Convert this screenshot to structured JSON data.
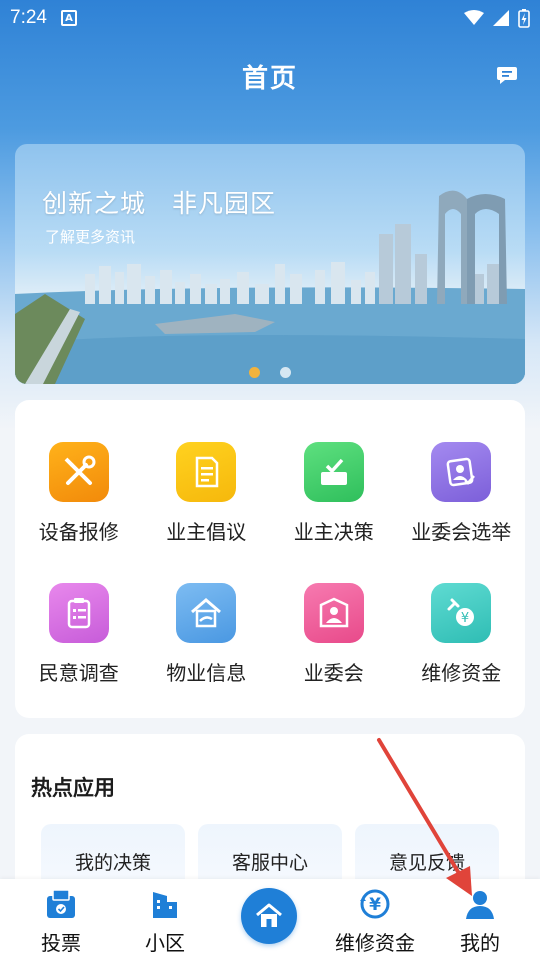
{
  "status_bar": {
    "time": "7:24",
    "notification_badge": "A"
  },
  "header": {
    "title": "首页"
  },
  "banner": {
    "title": "创新之城　非凡园区",
    "subtitle": "了解更多资讯",
    "active_dot": 0,
    "dot_count": 2
  },
  "menu": {
    "items": [
      {
        "label": "设备报修",
        "icon": "wrench-screwdriver-icon",
        "color": "#f59b0b"
      },
      {
        "label": "业主倡议",
        "icon": "document-icon",
        "color": "#f8c20e"
      },
      {
        "label": "业主决策",
        "icon": "ballot-box-icon",
        "color": "#3fcf6b"
      },
      {
        "label": "业委会选举",
        "icon": "election-card-icon",
        "color": "#8b6fe0"
      },
      {
        "label": "民意调查",
        "icon": "survey-clipboard-icon",
        "color": "#d86fe0"
      },
      {
        "label": "物业信息",
        "icon": "house-hand-icon",
        "color": "#5aa7ea"
      },
      {
        "label": "业委会",
        "icon": "committee-people-icon",
        "color": "#f0569a"
      },
      {
        "label": "维修资金",
        "icon": "yuan-fund-icon",
        "color": "#39c9c0"
      }
    ]
  },
  "hot_apps": {
    "title": "热点应用",
    "items": [
      {
        "label": "我的决策"
      },
      {
        "label": "客服中心"
      },
      {
        "label": "意见反馈"
      }
    ]
  },
  "tabbar": {
    "items": [
      {
        "label": "投票",
        "icon": "ballot-icon"
      },
      {
        "label": "小区",
        "icon": "building-icon"
      },
      {
        "label": "",
        "icon": "home-icon"
      },
      {
        "label": "维修资金",
        "icon": "yuan-coin-icon"
      },
      {
        "label": "我的",
        "icon": "user-icon"
      }
    ]
  },
  "colors": {
    "primary": "#1f7fd7",
    "annotation_arrow": "#e0443a"
  }
}
